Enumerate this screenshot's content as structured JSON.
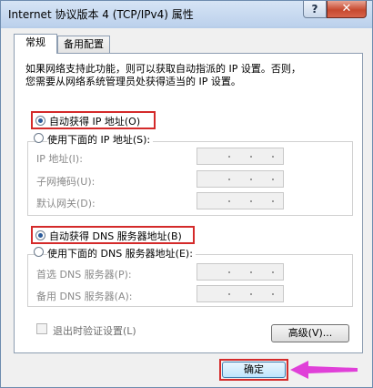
{
  "window": {
    "title": "Internet 协议版本 4 (TCP/IPv4) 属性",
    "help_glyph": "?",
    "close_glyph": "✕"
  },
  "tabs": [
    {
      "label": "常规",
      "active": true
    },
    {
      "label": "备用配置",
      "active": false
    }
  ],
  "description": "如果网络支持此功能，则可以获取自动指派的 IP 设置。否则，\n您需要从网络系统管理员处获得适当的 IP 设置。",
  "ip_section": {
    "auto_label": "自动获得 IP 地址(O)",
    "manual_label": "使用下面的 IP 地址(S):",
    "auto_selected": true,
    "fields": [
      {
        "label": "IP 地址(I):",
        "value": ""
      },
      {
        "label": "子网掩码(U):",
        "value": ""
      },
      {
        "label": "默认网关(D):",
        "value": ""
      }
    ]
  },
  "dns_section": {
    "auto_label": "自动获得 DNS 服务器地址(B)",
    "manual_label": "使用下面的 DNS 服务器地址(E):",
    "auto_selected": true,
    "fields": [
      {
        "label": "首选 DNS 服务器(P):",
        "value": ""
      },
      {
        "label": "备用 DNS 服务器(A):",
        "value": ""
      }
    ]
  },
  "validate_on_exit": {
    "label": "退出时验证设置(L)",
    "checked": false,
    "enabled": false
  },
  "advanced_button": "高级(V)...",
  "ok_button": "确定",
  "colors": {
    "highlight_box": "#d42a2a",
    "annotation_arrow": "#e040d8"
  }
}
